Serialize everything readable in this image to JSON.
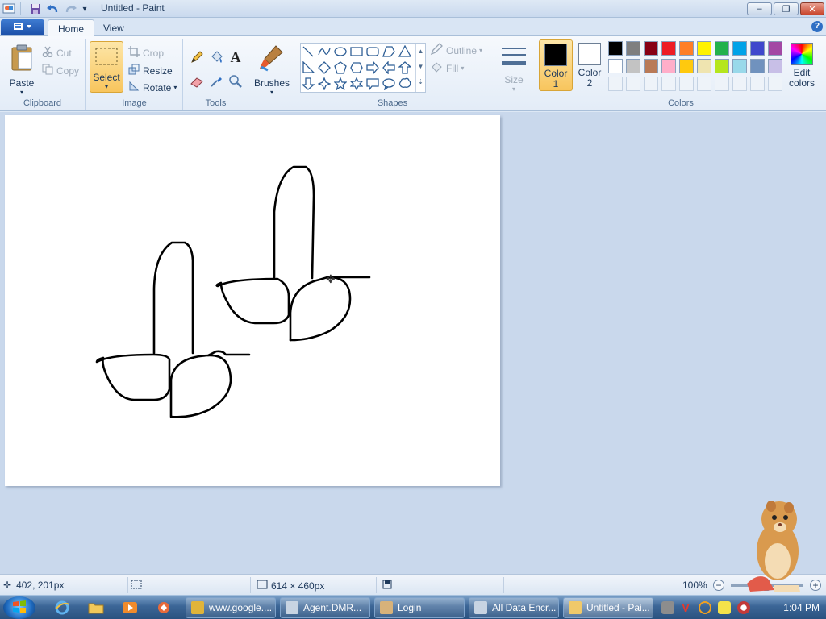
{
  "window": {
    "title": "Untitled - Paint",
    "controls": {
      "minimize": "–",
      "maximize": "❐",
      "close": "✕"
    }
  },
  "quick_access": {
    "save_icon": "save-icon",
    "undo_icon": "undo-icon",
    "redo_icon": "redo-icon",
    "customize": "▾"
  },
  "tabs": {
    "home": "Home",
    "view": "View",
    "help": "?"
  },
  "ribbon": {
    "clipboard": {
      "paste": "Paste",
      "cut": "Cut",
      "copy": "Copy",
      "label": "Clipboard"
    },
    "image": {
      "select": "Select",
      "crop": "Crop",
      "resize": "Resize",
      "rotate": "Rotate",
      "label": "Image"
    },
    "tools": {
      "label": "Tools",
      "text_glyph": "A"
    },
    "brushes": {
      "label": "Brushes"
    },
    "shapes": {
      "outline": "Outline",
      "fill": "Fill",
      "label": "Shapes"
    },
    "size": {
      "label": "Size"
    },
    "colors": {
      "color1_label": "Color",
      "color1_num": "1",
      "color2_label": "Color",
      "color2_num": "2",
      "edit_label_1": "Edit",
      "edit_label_2": "colors",
      "label": "Colors",
      "color1": "#000000",
      "color2": "#ffffff",
      "palette_row1": [
        "#000000",
        "#7f7f7f",
        "#880015",
        "#ed1c24",
        "#ff7f27",
        "#fff200",
        "#22b14c",
        "#00a2e8",
        "#3f48cc",
        "#a349a4"
      ],
      "palette_row2": [
        "#ffffff",
        "#c3c3c3",
        "#b97a57",
        "#ffaec9",
        "#ffc90e",
        "#efe4b0",
        "#b5e61d",
        "#99d9ea",
        "#7092be",
        "#c8bfe7"
      ]
    }
  },
  "status": {
    "cursor_pos": "402, 201px",
    "image_size": "614 × 460px",
    "zoom": "100%",
    "zoom_out": "−",
    "zoom_in": "+"
  },
  "taskbar": {
    "tasks": [
      {
        "label": "www.google....",
        "icon": "chrome-icon",
        "color": "#e0b43a"
      },
      {
        "label": "Agent.DMR...",
        "icon": "window-icon",
        "color": "#c8d4e2"
      },
      {
        "label": "Login",
        "icon": "user-icon",
        "color": "#d7b27a"
      },
      {
        "label": "All Data Encr...",
        "icon": "window-icon",
        "color": "#c8d4e2"
      },
      {
        "label": "Untitled - Pai...",
        "icon": "paint-icon",
        "color": "#f0c96a"
      }
    ],
    "clock": "1:04 PM"
  }
}
